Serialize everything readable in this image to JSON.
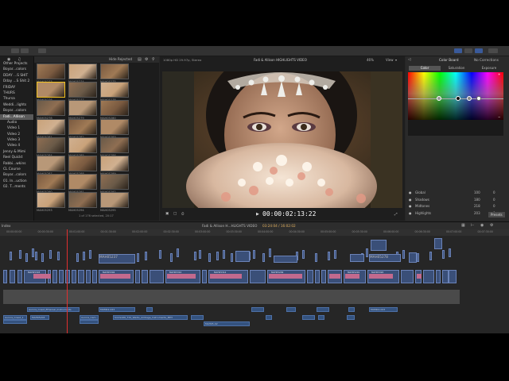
{
  "sidebar": {
    "items": [
      {
        "label": "Other Projects"
      },
      {
        "label": "Boyar...colors"
      },
      {
        "label": "DDAY ...S SHIT"
      },
      {
        "label": "Dday ...S Shit 2"
      },
      {
        "label": "FRIDAY"
      },
      {
        "label": "THURS"
      },
      {
        "label": "Thursa"
      },
      {
        "label": "Weddi...lights"
      },
      {
        "label": "Boyar...colors"
      },
      {
        "label": "Fadi...Allison"
      },
      {
        "label": "Audio"
      },
      {
        "label": "Video 1"
      },
      {
        "label": "Video 2"
      },
      {
        "label": "Video 3"
      },
      {
        "label": "Video 4"
      },
      {
        "label": "Jenny & Mimi"
      },
      {
        "label": "Reel Quickt"
      },
      {
        "label": "Rabbi...wkins"
      },
      {
        "label": "CL Course"
      },
      {
        "label": "Boyar...colors"
      },
      {
        "label": "01. In...uction"
      },
      {
        "label": "02. T...ments"
      }
    ]
  },
  "browser": {
    "filter_label": "Hide Rejected",
    "status": "1 of 176 selected, 20:17",
    "clips": [
      "MAH05273",
      "MAH05274",
      "MAH05275",
      "MAH05276",
      "MAH05277",
      "MAH05278",
      "MAH05278",
      "MAH05279",
      "MAH05280",
      "MAH05281",
      "MAH05282",
      "MAH05283",
      "MAH05284",
      "MAH05285",
      "MAH05286",
      "MAH05287",
      "MAH05288",
      "MAH05289",
      "MAH05290",
      "MAH05291",
      "MAH05292",
      "MAH05293",
      "MAH05294",
      "MAH05295"
    ]
  },
  "viewer": {
    "format": "1080p HD 29.97p, Stereo",
    "title": "Fadi & Allison HIGHLIGHTS VIDEO",
    "zoom": "46%",
    "view_label": "View",
    "timecode": "00:00:02:13:22"
  },
  "inspector": {
    "title": "Color Board",
    "correction": "No Corrections",
    "tabs": [
      "Color",
      "Saturation",
      "Exposure"
    ],
    "rows": [
      {
        "label": "Global",
        "v1": "100",
        "v2": "0"
      },
      {
        "label": "Shadows",
        "v1": "180",
        "v2": "0"
      },
      {
        "label": "Midtones",
        "v1": "218",
        "v2": "0"
      },
      {
        "label": "Highlights",
        "v1": "203",
        "v2": "0"
      }
    ],
    "presets_label": "Presets"
  },
  "timeline": {
    "index_label": "Index",
    "project": "Fadi & Allison H...HLIGHTS VIDEO",
    "duration": "03:24:04 / 16:02:02",
    "ruler_ticks": [
      "00:00:00:00",
      "00:00:30:00",
      "00:01:00:00",
      "00:01:30:00",
      "00:02:00:00",
      "00:02:30:00",
      "00:03:00:00",
      "00:03:30:00",
      "00:04:00:00",
      "00:04:30:00",
      "00:05:00:00",
      "00:05:30:00",
      "00:06:00:00",
      "00:06:30:00",
      "00:07:00:00",
      "00:07:30:00",
      "00:08:00:00"
    ],
    "clip_labels": [
      "MAH05237",
      "MAH05278",
      "MAH05303",
      "MAH05304",
      "MAH05310",
      "MAH05312",
      "MAH05209",
      "MAH05291",
      "MAH05320",
      "MAH05290"
    ],
    "audio_labels": [
      "Aurora_Coast_Ethereal_Instruments",
      "MOM02-023",
      "Aurora_Coast_1",
      "MAH05203",
      "Aurora_Cam...",
      "Sinmix66_T1S_Wedis_Ambage_Instruments_MP3",
      "MAH05-02",
      "MOM02-023",
      "MAH05-02"
    ]
  },
  "colors": {
    "accent": "#3a5a9a",
    "clip_video": "#3a4f78",
    "clip_pink": "#c26a8e",
    "playhead": "#e03030",
    "timecode": "#ffffff"
  }
}
